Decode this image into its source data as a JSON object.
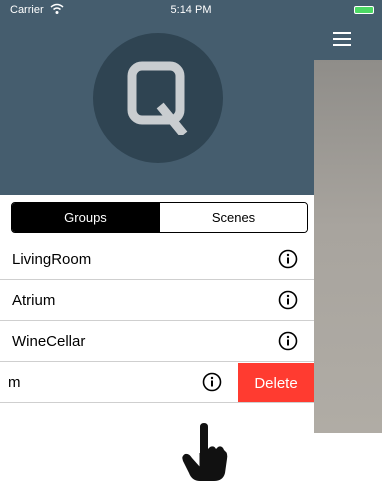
{
  "status_bar": {
    "carrier": "Carrier",
    "time": "5:14 PM"
  },
  "header": {
    "logo_icon": "q-logo-icon"
  },
  "segmented": {
    "groups_label": "Groups",
    "scenes_label": "Scenes",
    "selected": "Groups"
  },
  "list": {
    "items": [
      {
        "label": "LivingRoom"
      },
      {
        "label": "Atrium"
      },
      {
        "label": "WineCellar"
      },
      {
        "label": "m",
        "delete_label": "Delete"
      }
    ]
  },
  "colors": {
    "header_bg": "#455d6e",
    "logo_circle": "#2f4452",
    "delete_red": "#ff3b30",
    "battery_green": "#4cd964"
  },
  "icons": {
    "menu": "hamburger-icon",
    "info": "info-circle-icon",
    "gesture": "pointing-hand-icon"
  }
}
